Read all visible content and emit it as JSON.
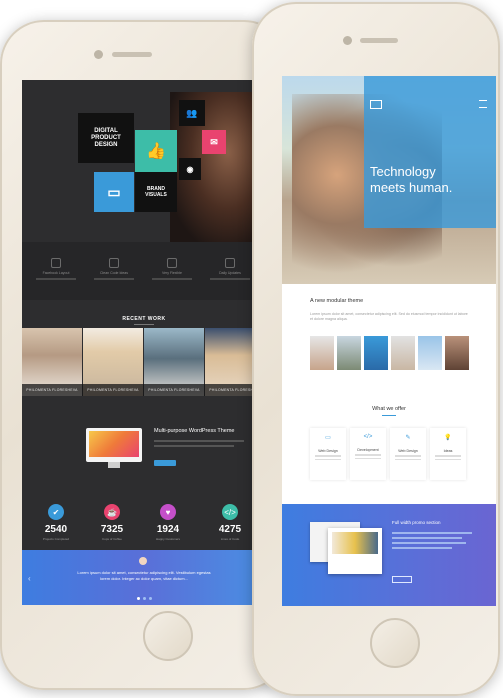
{
  "left_screen": {
    "hero": {
      "title": "DIGITAL PRODUCT DESIGN",
      "brand_visuals": "BRAND VISUALS"
    },
    "features": [
      {
        "title": "Facebook Layout",
        "icon": "layout-icon"
      },
      {
        "title": "Clean Code Ideas",
        "icon": "code-icon"
      },
      {
        "title": "Very Flexible",
        "icon": "flex-icon"
      },
      {
        "title": "Daily Updates",
        "icon": "refresh-icon"
      }
    ],
    "recent_work_title": "RECENT WORK",
    "work_captions": [
      "PHILOMENTA FLORESHEVA",
      "PHILOMENTA FLORESHEVA",
      "PHILOMENTA FLORESHEVA",
      "PHILOMENTA FLORESHEVA"
    ],
    "promo_title": "Multi-purpose WordPress Theme",
    "stats": [
      {
        "value": "2540",
        "label": "Projects Completed",
        "color": "#3a9ad9",
        "icon": "check-icon"
      },
      {
        "value": "7325",
        "label": "Cups of Coffee",
        "color": "#e9436f",
        "icon": "cup-icon"
      },
      {
        "value": "1924",
        "label": "Happy Customers",
        "color": "#c44fc9",
        "icon": "heart-icon"
      },
      {
        "value": "4275",
        "label": "Lines of Code",
        "color": "#3dbda8",
        "icon": "code-icon"
      }
    ],
    "testimonial": "Lorem ipsum dolor sit amet, consectetur adipiscing elit. Vestibulum egestas lorem dolor. Integer ac dolor quam, vitae dictum..."
  },
  "right_screen": {
    "hero_heading_line1": "Technology",
    "hero_heading_line2": "meets human.",
    "section_title": "A new modular theme",
    "body_text": "Lorem ipsum dolor sit amet, consectetur adipiscing elit. Sed do eiusmod tempor incididunt ut labore et dolore magna aliqua.",
    "what_we_offer": "What we offer",
    "cards": [
      {
        "title": "Web Design",
        "icon": "desktop-icon"
      },
      {
        "title": "Development",
        "icon": "code-icon"
      },
      {
        "title": "Web Design",
        "icon": "pen-icon"
      },
      {
        "title": "Ideas",
        "icon": "bulb-icon"
      }
    ],
    "promo_title": "Full width promo section",
    "colors": {
      "accent": "#3a9ad9"
    }
  }
}
